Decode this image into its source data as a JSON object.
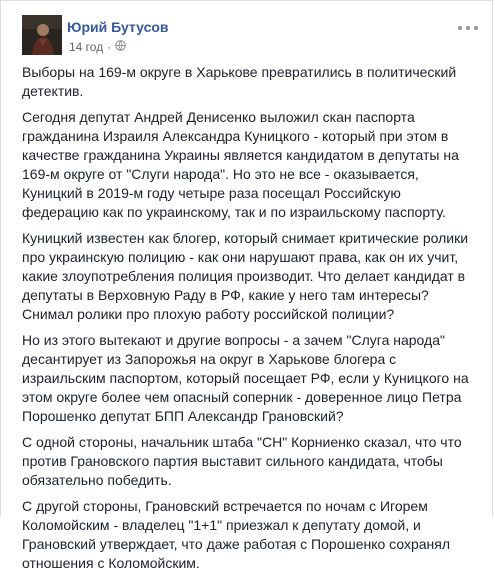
{
  "post": {
    "author": "Юрий Бутусов",
    "timestamp": "14 год",
    "separator": "·",
    "more_icon": "more-horizontal-icon",
    "privacy_icon": "globe-icon",
    "paragraphs": [
      "Выборы на 169-м округе в Харькове превратились в политический детектив.",
      "Сегодня депутат Андрей Денисенко выложил скан паспорта гражданина Израиля Александра Куницкого - который при этом в качестве гражданина Украины является кандидатом в депутаты на 169-м округе от \"Слуги народа\". Но это не все - оказывается, Куницкий в 2019-м году четыре раза посещал Российскую федерацию как по украинскому, так и по израильскому паспорту.",
      "Куницкий известен как блогер, который снимает критические ролики про украинскую полицию - как они нарушают права, как он их учит, какие злоупотребления полиция производит. Что делает кандидат в депутаты в Верховную Раду в РФ, какие у него там интересы? Снимал ролики про плохую работу российской полиции?",
      "Но из этого вытекают и другие вопросы - а зачем \"Слуга народа\" десантирует из Запорожья на округ в Харькове блогера с израильским паспортом, который посещает РФ, если у Куницкого на этом округе более чем опасный соперник - доверенное лицо Петра Порошенко депутат БПП Александр Грановский?",
      "С одной стороны, начальник штаба \"СН\" Корниенко сказал, что что против Грановского партия выставит сильного кандидата, чтобы обязательно победить.",
      "С другой стороны, Грановский встречается по ночам с Игорем Коломойским - владелец \"1+1\" приезжал к депутату домой, и Грановский утверждает, что даже работая с Порошенко сохранял отношения с Коломойским."
    ]
  }
}
